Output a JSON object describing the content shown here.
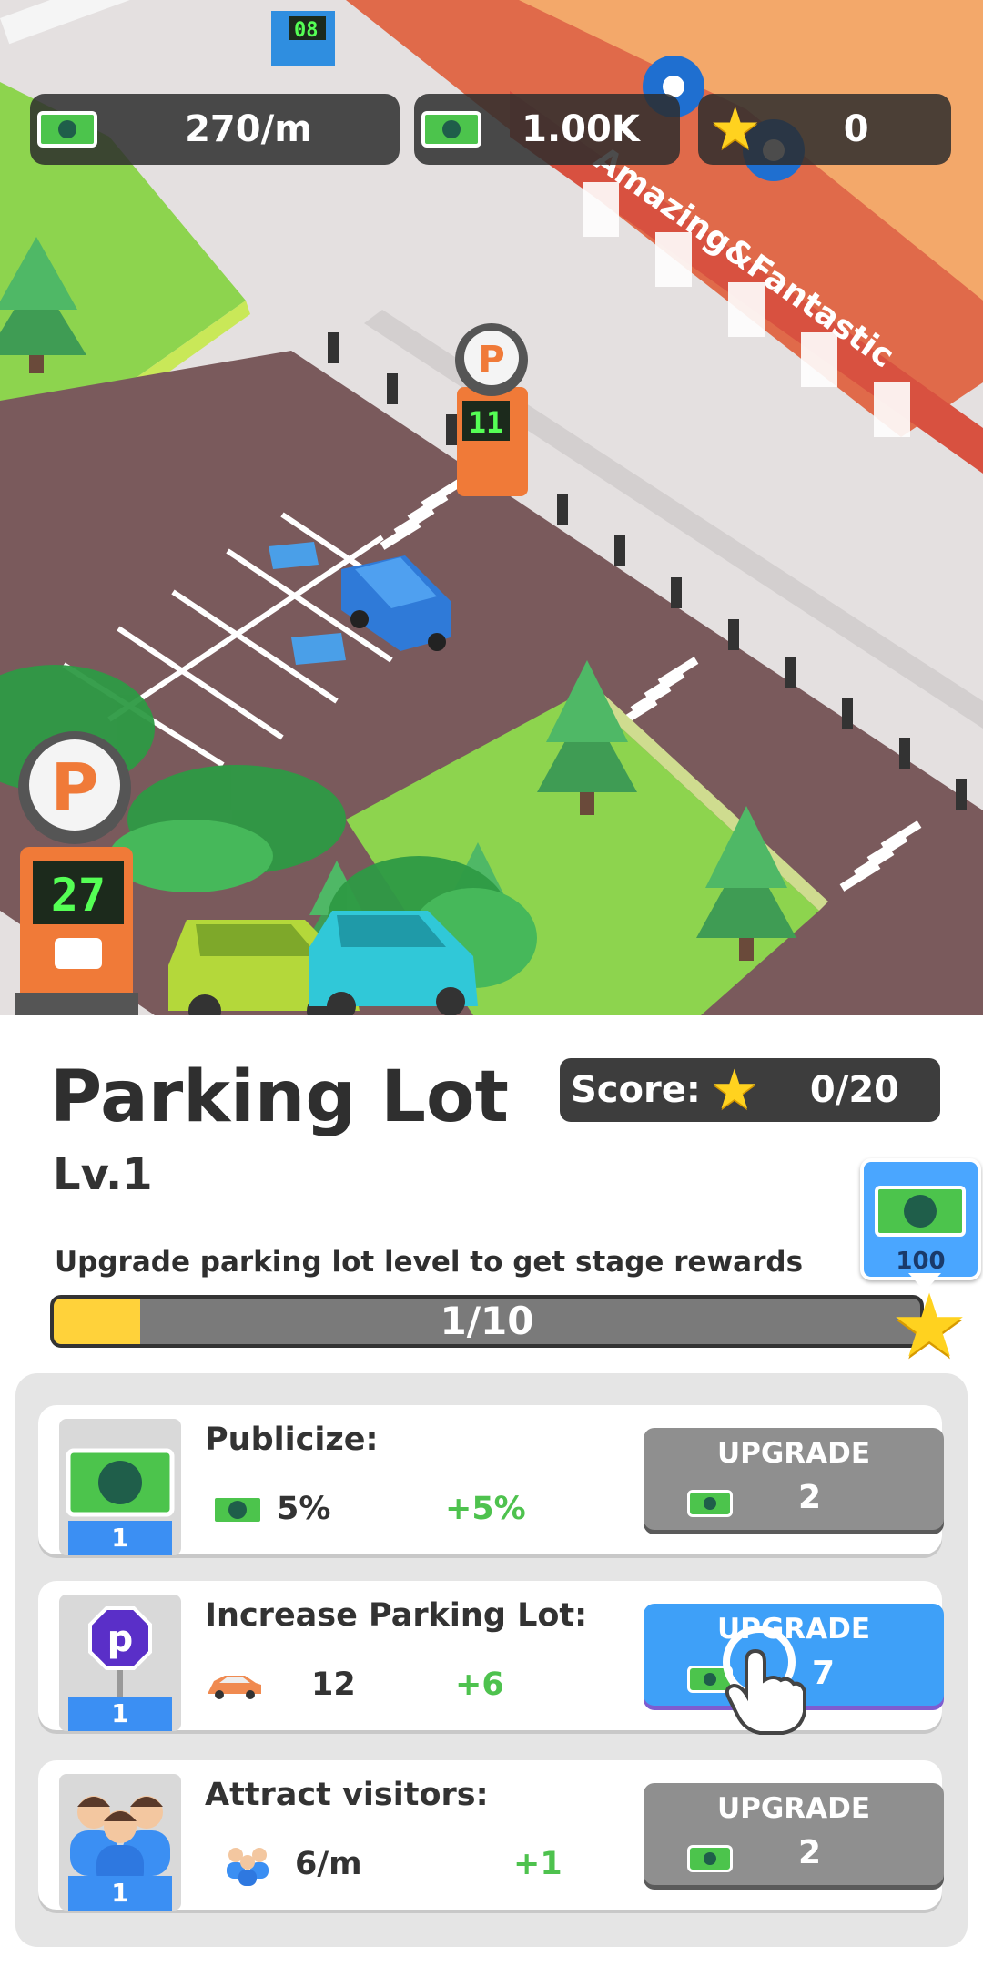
{
  "hud": {
    "income_rate": "270/m",
    "cash": "1.00K",
    "stars": "0"
  },
  "scene": {
    "lot_counter_small": "11",
    "lot_counter_big": "27",
    "gate_sign": "08",
    "store_sign": "Amazing&Fantastic",
    "parking_symbol": "P"
  },
  "building": {
    "title": "Parking Lot",
    "level": "Lv.1"
  },
  "score": {
    "label": "Score:",
    "value": "0/20"
  },
  "stage": {
    "description": "Upgrade parking lot level to get stage rewards",
    "progress_text": "1/10",
    "progress_fraction": 0.1,
    "reward_amount": "100"
  },
  "upgrades": [
    {
      "name": "Publicize:",
      "level": "1",
      "value": "5%",
      "increment": "+5%",
      "button": "UPGRADE",
      "cost": "2",
      "icon": "cash-icon",
      "active": false
    },
    {
      "name": "Increase Parking Lot:",
      "level": "1",
      "value": "12",
      "increment": "+6",
      "button": "UPGRADE",
      "cost": "7",
      "icon": "car-icon",
      "active": true
    },
    {
      "name": "Attract visitors:",
      "level": "1",
      "value": "6/m",
      "increment": "+1",
      "button": "UPGRADE",
      "cost": "2",
      "icon": "visitors-icon",
      "active": false
    }
  ],
  "colors": {
    "accent_blue": "#3ea0f8",
    "button_gray": "#8f8f8f",
    "increment_green": "#4ec24e",
    "progress_yellow": "#ffd23a",
    "asphalt": "#7a5a5c",
    "grass": "#8dd44e"
  }
}
